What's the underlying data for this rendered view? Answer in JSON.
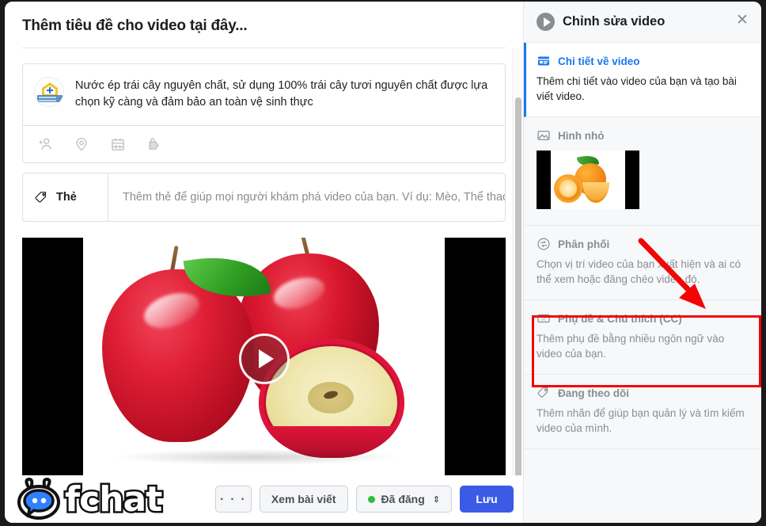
{
  "dialog": {
    "title_placeholder": "Thêm tiêu đề cho video tại đây..."
  },
  "composer": {
    "description": "Nước ép trái cây nguyên chất, sử dụng 100% trái cây tươi nguyên chất được lựa chọn kỹ càng và đảm bảo an toàn vệ sinh thực",
    "icons": [
      {
        "name": "tag-people-icon",
        "label": "Gắn thẻ người khác"
      },
      {
        "name": "location-pin-icon",
        "label": "Vị trí"
      },
      {
        "name": "calendar-icon",
        "label": "Sự kiện"
      },
      {
        "name": "product-tag-icon",
        "label": "Sản phẩm"
      }
    ]
  },
  "tags": {
    "label": "Thẻ",
    "placeholder": "Thêm thẻ để giúp mọi người khám phá video của bạn. Ví dụ: Mèo, Thể thao, Pian"
  },
  "player": {
    "icon": "play-icon",
    "content": "Hai quả táo đỏ và nửa quả táo cắt đôi"
  },
  "footer": {
    "more_label": "· · ·",
    "view_post_label": "Xem bài viết",
    "status_label": "Đã đăng",
    "status_caret": "⇕",
    "status_color": "#2dbf3e",
    "save_label": "Lưu",
    "save_color": "#3b5ae5"
  },
  "watermark": {
    "text": "fchat"
  },
  "panel": {
    "title": "Chỉnh sửa video",
    "close_label": "✕",
    "accent_color": "#1877f2",
    "highlight_color": "#f30505",
    "items": [
      {
        "icon": "video-details-icon",
        "name": "Chi tiết về video",
        "desc": "Thêm chi tiết vào video của bạn và tạo bài viết video.",
        "active": true
      },
      {
        "icon": "image-thumbnail-icon",
        "name": "Hình nhỏ",
        "desc": "",
        "active": false
      },
      {
        "icon": "distribution-icon",
        "name": "Phân phối",
        "desc": "Chọn vị trí video của bạn xuất hiện và ai có thể xem hoặc đăng chéo video đó.",
        "active": false
      },
      {
        "icon": "closed-caption-icon",
        "name": "Phụ đề & Chú thích (CC)",
        "desc": "Thêm phụ đề bằng nhiều ngôn ngữ vào video của bạn.",
        "active": false,
        "highlighted": true
      },
      {
        "icon": "tag-outline-icon",
        "name": "Đang theo dõi",
        "desc": "Thêm nhãn để giúp bạn quản lý và tìm kiếm video của mình.",
        "active": false
      }
    ]
  }
}
